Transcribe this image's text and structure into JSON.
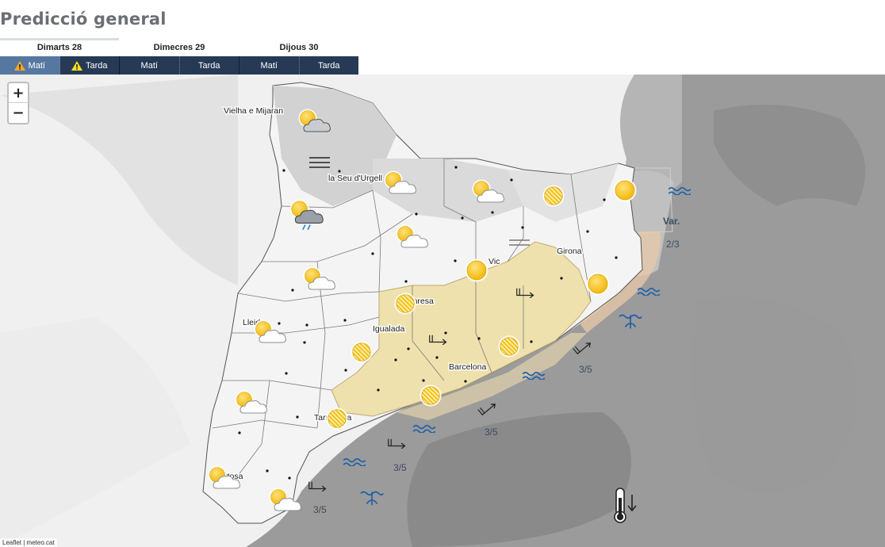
{
  "page_title": "Predicció general",
  "days": [
    {
      "label": "Dimarts 28"
    },
    {
      "label": "Dimecres 29"
    },
    {
      "label": "Dijous 30"
    }
  ],
  "tabs": [
    {
      "label": "Matí",
      "warning": true,
      "active": true
    },
    {
      "label": "Tarda",
      "warning": true,
      "active": false
    },
    {
      "label": "Matí",
      "warning": false,
      "active": false
    },
    {
      "label": "Tarda",
      "warning": false,
      "active": false
    },
    {
      "label": "Matí",
      "warning": false,
      "active": false
    },
    {
      "label": "Tarda",
      "warning": false,
      "active": false
    }
  ],
  "zoom": {
    "in": "+",
    "out": "−"
  },
  "attribution": "Leaflet | meteo.cat",
  "places": [
    "Vielha e Mijaran",
    "la Seu d'Urgell",
    "Vic",
    "Girona",
    "Manresa",
    "Igualada",
    "Lleida",
    "Barcelona",
    "Tarragona",
    "Tortosa"
  ],
  "sea_state_labels": [
    "Var.",
    "2/3",
    "3/5",
    "3/5",
    "3/5",
    "3/5"
  ],
  "weather_icons": [
    "sun-cloud-icon",
    "sun-cloud-rain-icon",
    "sun-icon",
    "haze-sun-icon",
    "fog-icon",
    "wind-icon",
    "wave-icon",
    "waterspout-icon",
    "thermometer-down-icon"
  ],
  "colors": {
    "warning_area": "#efe0a8",
    "sea_warning": "#e8c9a8",
    "tab_bar": "#263a55",
    "tab_active": "#56779f",
    "sun": "#f6c21a"
  }
}
